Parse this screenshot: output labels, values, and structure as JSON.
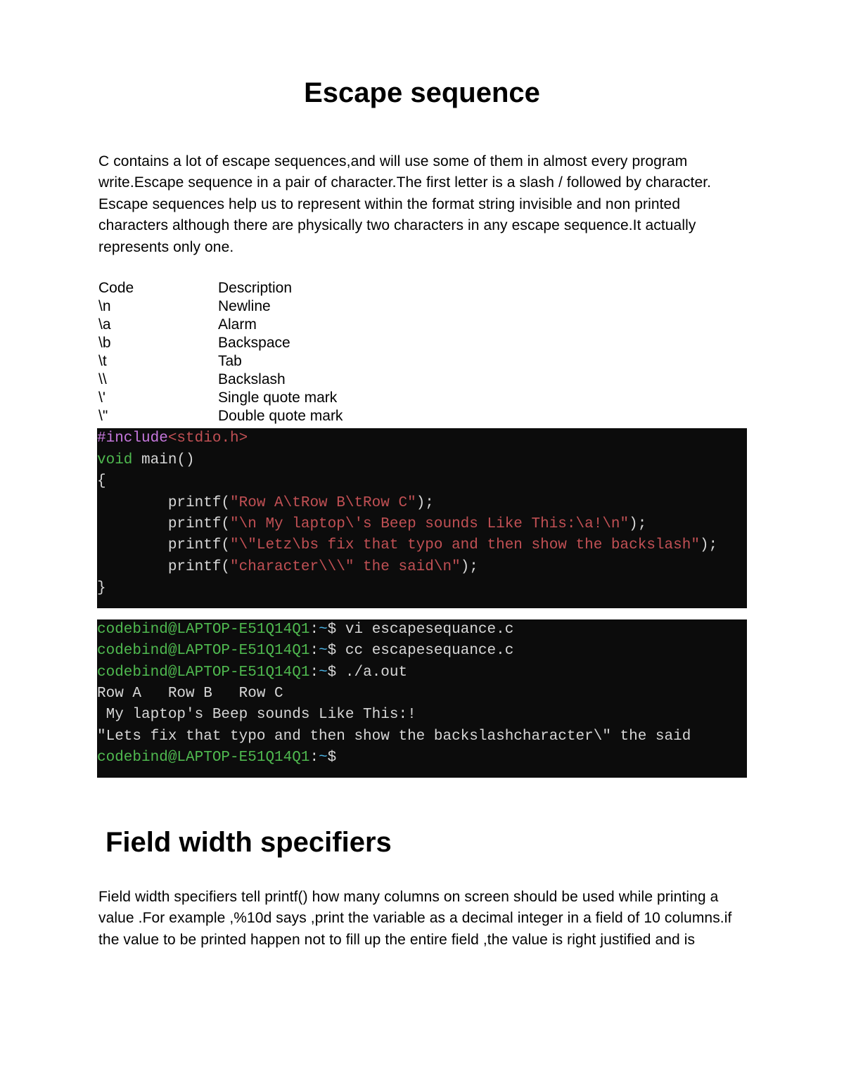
{
  "title1": "Escape sequence",
  "para1": "C contains a lot of escape sequences,and will use some of them in almost every program write.Escape sequence in a pair of character.The first letter is a slash / followed by character. Escape sequences help us to represent within the format string invisible and non printed characters although there are physically two characters in any escape sequence.It actually represents  only one.",
  "table": {
    "header": {
      "c1": "Code",
      "c2": "Description"
    },
    "rows": [
      {
        "c1": "\\n",
        "c2": "Newline"
      },
      {
        "c1": "\\a",
        "c2": "Alarm"
      },
      {
        "c1": "\\b",
        "c2": "Backspace"
      },
      {
        "c1": "\\t",
        "c2": "Tab"
      },
      {
        "c1": "\\\\",
        "c2": "Backslash"
      },
      {
        "c1": "\\'",
        "c2": "Single quote mark"
      },
      {
        "c1": "\\\"",
        "c2": "Double quote mark"
      }
    ]
  },
  "code": {
    "l1a": "#include",
    "l1b": "<stdio.h>",
    "l2a": "void",
    "l2b": " main()",
    "l3": "{",
    "l4a": "        printf(",
    "l4b": "\"Row A\\tRow B\\tRow C\"",
    "l4c": ");",
    "l5a": "        printf(",
    "l5b": "\"\\n My laptop\\'s Beep sounds Like This:\\a!\\n\"",
    "l5c": ");",
    "l6a": "        printf(",
    "l6b": "\"\\\"Letz\\bs fix that typo and then show the backslash\"",
    "l6c": ");",
    "l7a": "        printf(",
    "l7b": "\"character\\\\\\\" the said\\n\"",
    "l7c": ");",
    "l8": "}"
  },
  "term": {
    "user": "codebind@LAPTOP-E51Q14Q1",
    "path": "~",
    "cmd1": "vi escapesequance.c",
    "cmd2": "cc escapesequance.c",
    "cmd3": "./a.out",
    "out1": "Row A   Row B   Row C",
    "out2": " My laptop's Beep sounds Like This:!",
    "out3": "\"Lets fix that typo and then show the backslashcharacter\\\" the said"
  },
  "title2": "Field width specifiers",
  "para2": "Field width specifiers tell printf() how many columns on screen should be used while printing a value .For example ,%10d says ,print the variable as a decimal integer in a field of 10 columns.if the value to be printed happen not to fill up the entire field ,the value is right justified and  is"
}
